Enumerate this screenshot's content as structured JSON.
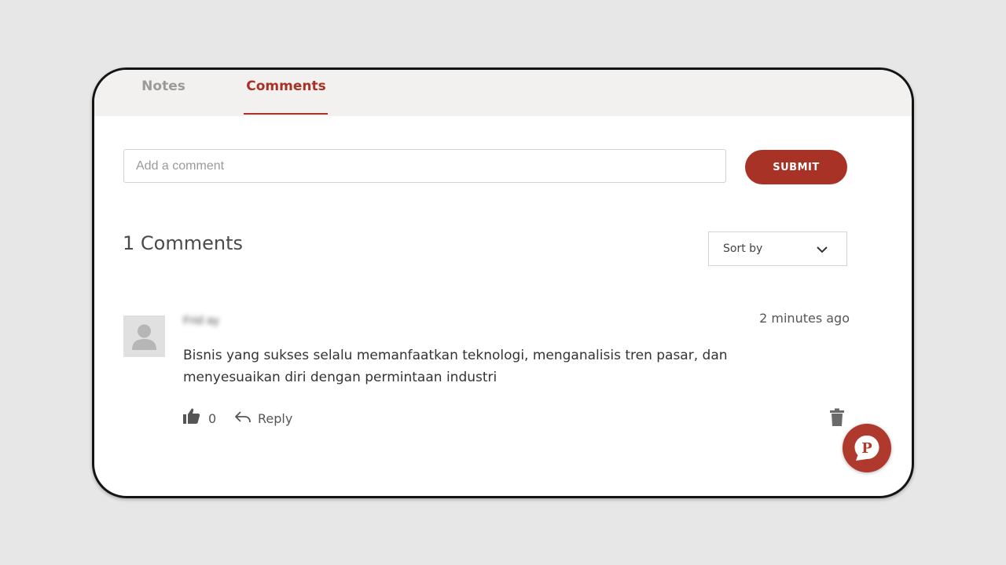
{
  "tabs": [
    {
      "label": "Notes",
      "active": false
    },
    {
      "label": "Comments",
      "active": true
    }
  ],
  "comment_form": {
    "placeholder": "Add a comment",
    "value": "",
    "submit_label": "SUBMIT"
  },
  "comments_header": {
    "count_label": "1 Comments",
    "sort_label": "Sort by",
    "sort_icon": "chevron-down-icon"
  },
  "comments": [
    {
      "author": "Frid ay",
      "avatar_icon": "user-avatar-icon",
      "timestamp": "2 minutes ago",
      "text": "Bisnis yang sukses selalu memanfaatkan teknologi, menganalisis tren pasar, dan menyesuaikan diri dengan permintaan industri",
      "likes": "0",
      "reply_label": "Reply"
    }
  ],
  "colors": {
    "accent": "#a93226",
    "background": "#e7e7e7",
    "tabbar": "#f2f1f0"
  },
  "chat_widget": {
    "icon": "chat-p-icon",
    "letter": "P"
  }
}
